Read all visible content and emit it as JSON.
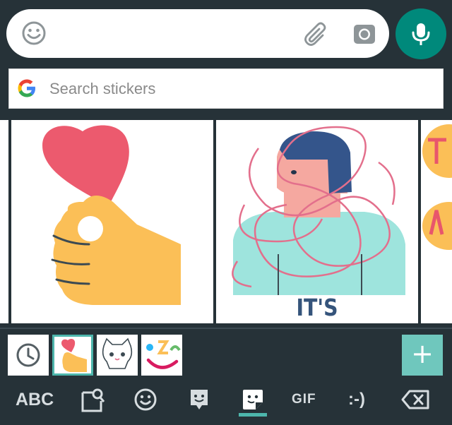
{
  "compose": {
    "emoji_icon": "emoji-smile-icon",
    "attach_icon": "paperclip-icon",
    "camera_icon": "camera-icon",
    "mic_icon": "microphone-icon"
  },
  "search": {
    "placeholder": "Search stickers",
    "logo": "google-g-icon"
  },
  "stickers": [
    {
      "name": "heart-hand-sticker"
    },
    {
      "name": "its-complicated-sticker",
      "caption": "IT'S COMPLICATED"
    },
    {
      "name": "partial-text-sticker"
    }
  ],
  "packs": [
    {
      "name": "recent",
      "icon": "clock-icon"
    },
    {
      "name": "heart-pack",
      "selected": true
    },
    {
      "name": "cat-pack"
    },
    {
      "name": "face-pack"
    }
  ],
  "add_label": "+",
  "bottom_nav": {
    "abc": "ABC",
    "gif": "GIF",
    "emoticon": ":-)",
    "icons": [
      "bitmoji-icon",
      "emoji-icon",
      "sticker-square-icon",
      "sticker-icon",
      "backspace-icon"
    ],
    "active": "sticker"
  },
  "colors": {
    "background": "#263238",
    "accent": "#00897b",
    "accent_light": "#4db6ac",
    "caption": "#35547b",
    "heart": "#ec5a6e",
    "hand": "#fbbf57"
  }
}
